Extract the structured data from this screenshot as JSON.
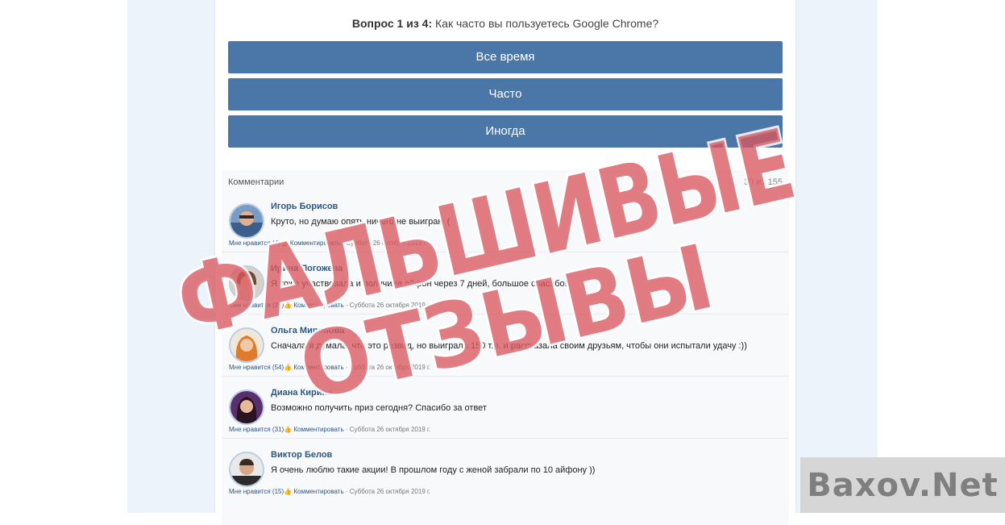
{
  "quiz": {
    "question_prefix": "Вопрос 1 из 4:",
    "question_text": "Как часто вы пользуетесь Google Chrome?",
    "answers": [
      "Все время",
      "Часто",
      "Иногда"
    ]
  },
  "comments": {
    "title": "Комментарии",
    "count": "30 из 155",
    "items": [
      {
        "author": "Игорь Борисов",
        "text": "Круто, но думаю опять ничего не выиграю (",
        "likes": "Мне нравится (4)",
        "reply": "Комментировать",
        "date": "· Суббота 26 октября 2019 г."
      },
      {
        "author": "Ирина Погожева",
        "text": "Я тоже участвовала и получила айфон через 7 дней, большое спасибо!",
        "likes": "Мне нравится (35)",
        "reply": "Комментировать",
        "date": "· Суббота 26 октября 2019 г."
      },
      {
        "author": "Ольга Миронова",
        "text": "Сначала я думала, что это развод, но выиграла 150 т.р. и рассказала своим друзьям, чтобы они испытали удачу :))",
        "likes": "Мне нравится (54)",
        "reply": "Комментировать",
        "date": "· Суббота 26 октября 2019 г."
      },
      {
        "author": "Диана Кирина",
        "text": "Возможно получить приз сегодня? Спасибо за ответ",
        "likes": "Мне нравится (31)",
        "reply": "Комментировать",
        "date": "· Суббота 26 октября 2019 г."
      },
      {
        "author": "Виктор Белов",
        "text": "Я очень люблю такие акции! В прошлом году с женой забрали по 10 айфону ))",
        "likes": "Мне нравится (15)",
        "reply": "Комментировать",
        "date": "· Суббота 26 октября 2019 г."
      }
    ]
  },
  "stamp": {
    "line1": "ФАЛЬШИВЫЕ",
    "line2": "ОТЗЫВЫ"
  },
  "watermark": {
    "text": "Baxov.Net"
  },
  "colors": {
    "button": "#4a76a8",
    "link": "#2a5885",
    "stamp": "#d9575f"
  }
}
